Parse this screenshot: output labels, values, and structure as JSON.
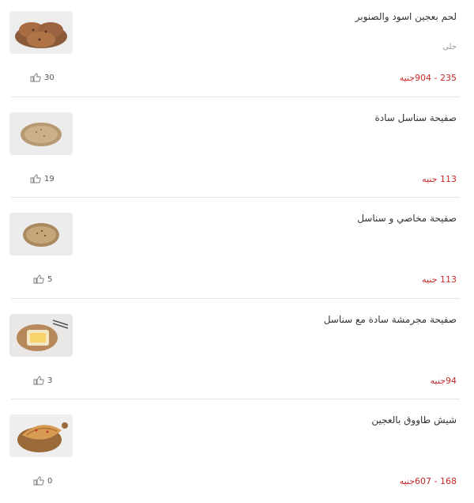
{
  "items": [
    {
      "title": "لحم بعجين اسود والصنوبر",
      "subtitle": "حلى",
      "price": "235 - 904جنيه",
      "likes": "30",
      "image": "round-dark-flatbreads-photo"
    },
    {
      "title": "صفيحة سناسل سادة",
      "subtitle": "",
      "price": "113 جنيه",
      "likes": "19",
      "image": "oval-flatbread-photo"
    },
    {
      "title": "صفيحة مخاصي و سناسل",
      "subtitle": "",
      "price": "113 جنيه",
      "likes": "5",
      "image": "round-flatbread-photo"
    },
    {
      "title": "صفيحة مجرمشة سادة مع سناسل",
      "subtitle": "",
      "price": "94جنيه",
      "likes": "3",
      "image": "square-pastry-on-board-photo"
    },
    {
      "title": "شيش طاووق بالعجين",
      "subtitle": "",
      "price": "168 - 607جنيه",
      "likes": "0",
      "image": "folded-pastry-on-board-photo"
    }
  ],
  "colors": {
    "price": "#c62828",
    "subtitle": "#9a9a9a",
    "divider": "#e4e4e4"
  },
  "icons": {
    "likes": "thumbs-up-icon"
  }
}
